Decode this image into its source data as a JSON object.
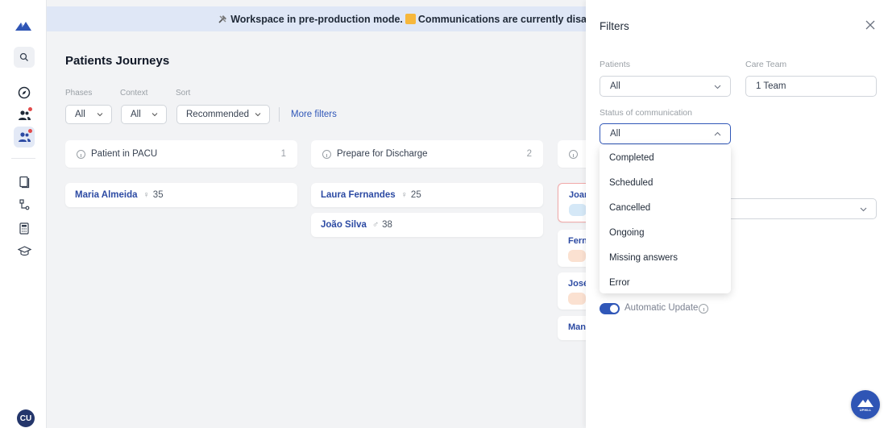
{
  "banner": {
    "icon": "tools-icon",
    "text_before": "Workspace in pre-production mode.",
    "text_after": "Communications are currently disa"
  },
  "rail": {
    "items": [
      "search-icon",
      "compass-icon",
      "users-icon",
      "users-active-icon",
      "bookmark-icon",
      "flow-icon",
      "calculator-icon",
      "graduation-cap-icon"
    ],
    "avatar": "CU"
  },
  "main": {
    "title": "Patients Journeys",
    "filters": {
      "phases": {
        "label": "Phases",
        "value": "All"
      },
      "context": {
        "label": "Context",
        "value": "All"
      },
      "sort": {
        "label": "Sort",
        "value": "Recommended"
      },
      "more": "More filters"
    },
    "columns": [
      {
        "title": "Patient in PACU",
        "count": "1",
        "cards": [
          {
            "name": "Maria Almeida",
            "sex": "♀",
            "age": "35"
          }
        ]
      },
      {
        "title": "Prepare for Discharge",
        "count": "2",
        "cards": [
          {
            "name": "Laura Fernandes",
            "sex": "♀",
            "age": "25"
          },
          {
            "name": "João Silva",
            "sex": "♂",
            "age": "38"
          }
        ]
      },
      {
        "title": "",
        "count": "",
        "cards": [
          {
            "name": "Joan"
          },
          {
            "name": "Fern"
          },
          {
            "name": "José"
          },
          {
            "name": "Man"
          }
        ]
      }
    ]
  },
  "panel": {
    "title": "Filters",
    "patients": {
      "label": "Patients",
      "value": "All"
    },
    "care_team": {
      "label": "Care Team",
      "value": "1 Team"
    },
    "status": {
      "label": "Status of communication",
      "value": "All"
    },
    "status_options": [
      "Completed",
      "Scheduled",
      "Cancelled",
      "Ongoing",
      "Missing answers",
      "Error"
    ],
    "auto_update": {
      "label": "Automatic Update",
      "enabled": true
    }
  },
  "colors": {
    "accent": "#3057b8",
    "banner_bg": "#dfe7f6",
    "nav": "#24366b",
    "alert_dot": "#e24b4b"
  }
}
